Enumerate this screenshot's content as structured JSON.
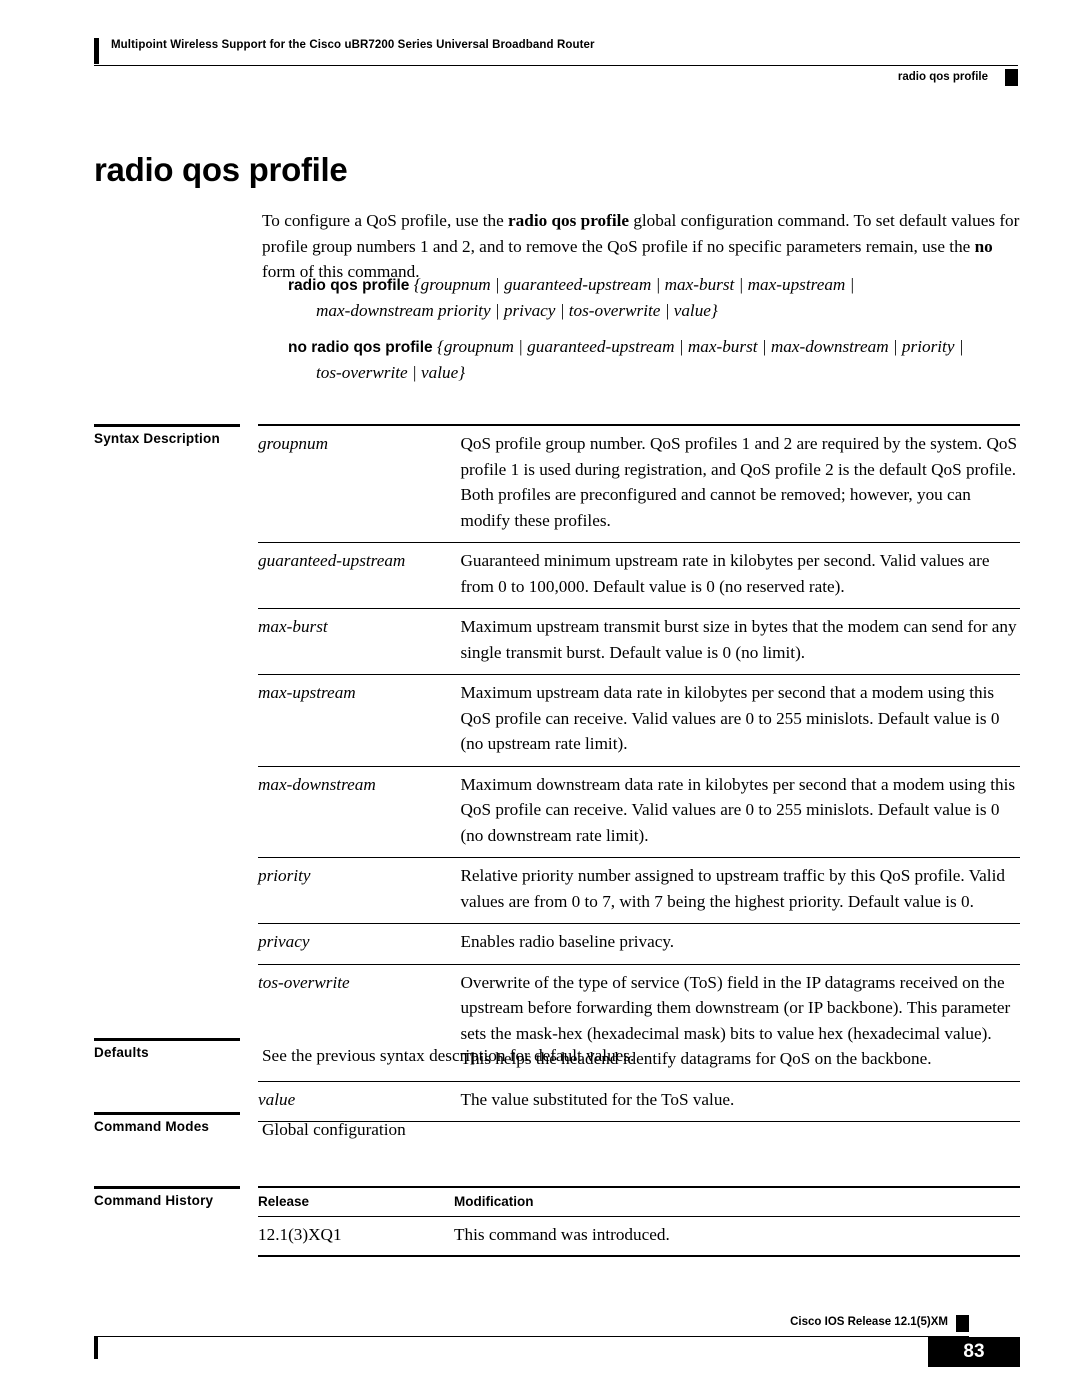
{
  "header": {
    "book_title": "Multipoint Wireless Support for the Cisco uBR7200 Series Universal Broadband Router",
    "running_head": "radio qos profile"
  },
  "page_title": "radio qos profile",
  "intro": {
    "part1": "To configure a QoS profile, use the ",
    "bold1": "radio qos profile",
    "part2": " global configuration command. To set default values for profile group numbers 1 and 2, and to remove the QoS profile if no specific parameters remain, use the ",
    "bold2": "no",
    "part3": " form of this command."
  },
  "syntax": {
    "command": "radio qos profile",
    "args_line1": "{groupnum | guaranteed-upstream | max-burst | max-upstream |",
    "args_line2": "max-downstream priority | privacy | tos-overwrite | value}",
    "no_command": "no radio qos profile",
    "no_args_line1": "{groupnum | guaranteed-upstream | max-burst | max-downstream | priority |",
    "no_args_line2": "tos-overwrite | value}"
  },
  "sections": {
    "syntax_description_label": "Syntax Description",
    "defaults_label": "Defaults",
    "defaults_text": "See the previous syntax description for default values.",
    "command_modes_label": "Command Modes",
    "command_modes_text": "Global configuration",
    "command_history_label": "Command History"
  },
  "syntax_rows": [
    {
      "term": "groupnum",
      "desc": "QoS profile group number. QoS profiles 1 and 2 are required by the system. QoS profile 1 is used during registration, and QoS profile 2 is the default QoS profile. Both profiles are preconfigured and cannot be removed; however, you can modify these profiles."
    },
    {
      "term": "guaranteed-upstream",
      "desc": "Guaranteed minimum upstream rate in kilobytes per second. Valid values are from 0 to 100,000. Default value is 0 (no reserved rate)."
    },
    {
      "term": "max-burst",
      "desc": "Maximum upstream transmit burst size in bytes that the modem can send for any single transmit burst. Default value is 0 (no limit)."
    },
    {
      "term": "max-upstream",
      "desc": "Maximum upstream data rate in kilobytes per second that a modem using this QoS profile can receive. Valid values are 0 to 255 minislots. Default value is 0 (no upstream rate limit)."
    },
    {
      "term": "max-downstream",
      "desc": "Maximum downstream data rate in kilobytes per second that a modem using this QoS profile can receive. Valid values are 0 to 255 minislots. Default value is 0 (no downstream rate limit)."
    },
    {
      "term": "priority",
      "desc": "Relative priority number assigned to upstream traffic by this QoS profile. Valid values are from 0 to 7, with 7 being the highest priority. Default value is 0."
    },
    {
      "term": "privacy",
      "desc": "Enables radio baseline privacy."
    },
    {
      "term": "tos-overwrite",
      "desc": "Overwrite of the type of service (ToS) field in the IP datagrams received on the upstream before forwarding them downstream (or IP backbone). This parameter sets the mask-hex (hexadecimal mask) bits to value hex (hexadecimal value). This helps the headend identify datagrams for QoS on the backbone."
    },
    {
      "term": "value",
      "desc": "The value substituted for the ToS value."
    }
  ],
  "history_table": {
    "headers": [
      "Release",
      "Modification"
    ],
    "rows": [
      [
        "12.1(3)XQ1",
        "This command was introduced."
      ]
    ]
  },
  "footer": {
    "release": "Cisco IOS Release 12.1(5)XM",
    "page_number": "83"
  }
}
